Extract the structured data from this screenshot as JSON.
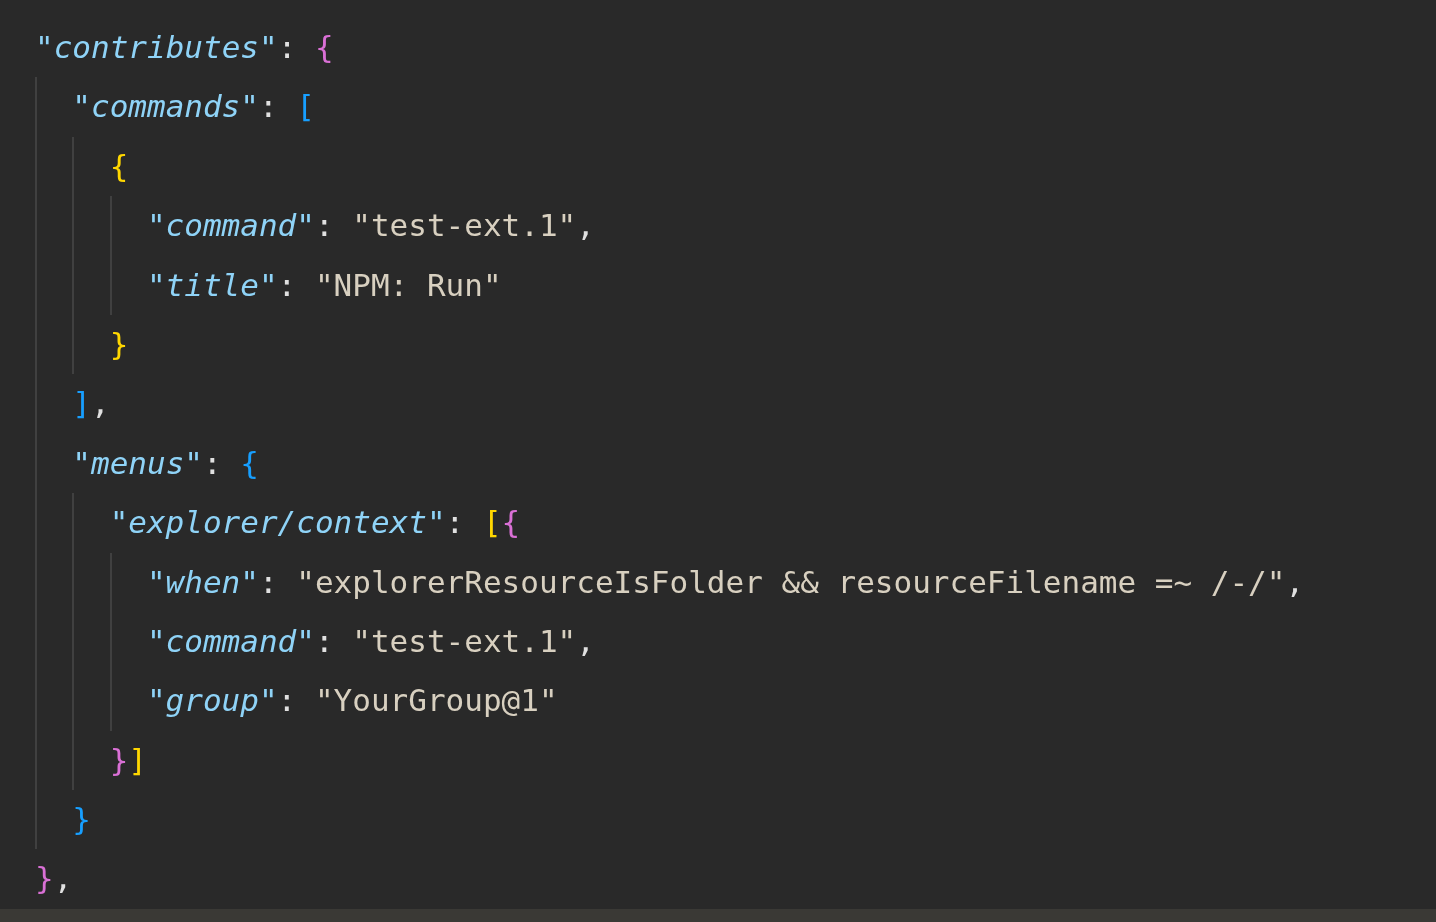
{
  "code": [
    {
      "tokens": [
        {
          "kind": "key",
          "text": "\"contributes\""
        },
        {
          "kind": "colon",
          "text": ":"
        },
        {
          "kind": "bracket",
          "text": "{",
          "color": "#da70d6"
        }
      ],
      "children": [
        {
          "tokens": [
            {
              "kind": "key",
              "text": "\"commands\""
            },
            {
              "kind": "colon",
              "text": ":"
            },
            {
              "kind": "bracket",
              "text": "[",
              "color": "#179fff"
            }
          ],
          "children": [
            {
              "tokens": [
                {
                  "kind": "bracket",
                  "text": "{",
                  "color": "#ffd700"
                }
              ],
              "children": [
                {
                  "tokens": [
                    {
                      "kind": "key",
                      "text": "\"command\""
                    },
                    {
                      "kind": "colon",
                      "text": ":"
                    },
                    {
                      "kind": "string",
                      "text": "\"test-ext.1\""
                    },
                    {
                      "kind": "comma",
                      "text": ","
                    }
                  ]
                },
                {
                  "tokens": [
                    {
                      "kind": "key",
                      "text": "\"title\""
                    },
                    {
                      "kind": "colon",
                      "text": ":"
                    },
                    {
                      "kind": "string",
                      "text": "\"NPM: Run\""
                    }
                  ]
                }
              ]
            },
            {
              "tokens": [
                {
                  "kind": "bracket",
                  "text": "}",
                  "color": "#ffd700"
                }
              ]
            }
          ]
        },
        {
          "tokens": [
            {
              "kind": "bracket",
              "text": "]",
              "color": "#179fff"
            },
            {
              "kind": "comma",
              "text": ","
            }
          ]
        },
        {
          "tokens": [
            {
              "kind": "key",
              "text": "\"menus\""
            },
            {
              "kind": "colon",
              "text": ":"
            },
            {
              "kind": "bracket",
              "text": "{",
              "color": "#179fff"
            }
          ],
          "children": [
            {
              "tokens": [
                {
                  "kind": "key",
                  "text": "\"explorer/context\""
                },
                {
                  "kind": "colon",
                  "text": ":"
                },
                {
                  "kind": "bracket",
                  "text": "[",
                  "color": "#ffd700"
                },
                {
                  "kind": "bracket",
                  "text": "{",
                  "color": "#da70d6"
                }
              ],
              "children": [
                {
                  "tokens": [
                    {
                      "kind": "key",
                      "text": "\"when\""
                    },
                    {
                      "kind": "colon",
                      "text": ":"
                    },
                    {
                      "kind": "string",
                      "text": "\"explorerResourceIsFolder && resourceFilename =~ /-/\""
                    },
                    {
                      "kind": "comma",
                      "text": ","
                    }
                  ]
                },
                {
                  "tokens": [
                    {
                      "kind": "key",
                      "text": "\"command\""
                    },
                    {
                      "kind": "colon",
                      "text": ":"
                    },
                    {
                      "kind": "string",
                      "text": "\"test-ext.1\""
                    },
                    {
                      "kind": "comma",
                      "text": ","
                    }
                  ]
                },
                {
                  "tokens": [
                    {
                      "kind": "key",
                      "text": "\"group\""
                    },
                    {
                      "kind": "colon",
                      "text": ":"
                    },
                    {
                      "kind": "string",
                      "text": "\"YourGroup@1\""
                    }
                  ]
                }
              ]
            },
            {
              "tokens": [
                {
                  "kind": "bracket",
                  "text": "}",
                  "color": "#da70d6"
                },
                {
                  "kind": "bracket",
                  "text": "]",
                  "color": "#ffd700"
                }
              ]
            }
          ]
        },
        {
          "tokens": [
            {
              "kind": "bracket",
              "text": "}",
              "color": "#179fff"
            }
          ]
        }
      ]
    },
    {
      "tokens": [
        {
          "kind": "bracket",
          "text": "}",
          "color": "#da70d6"
        },
        {
          "kind": "comma",
          "text": ","
        }
      ]
    }
  ]
}
